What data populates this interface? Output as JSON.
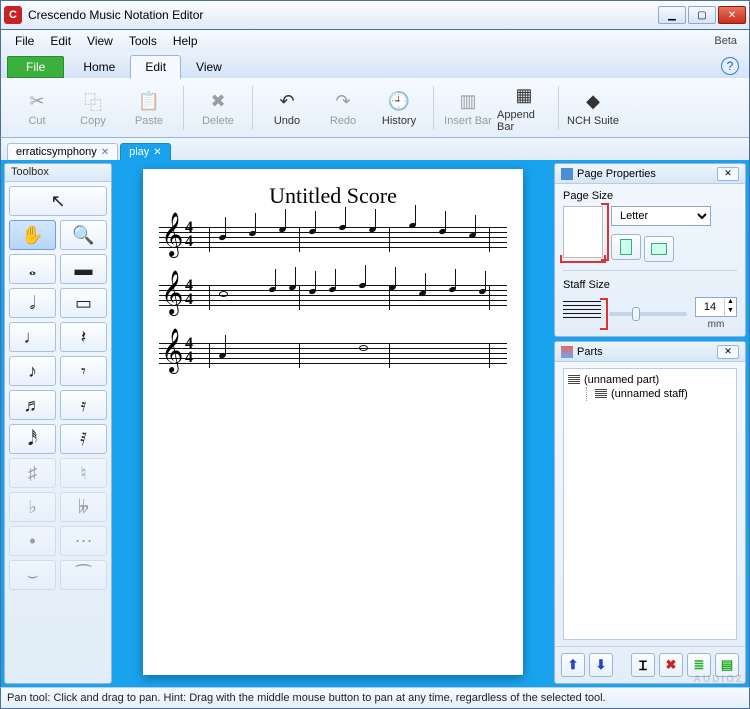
{
  "window": {
    "title": "Crescendo Music Notation Editor",
    "beta": "Beta"
  },
  "menubar": [
    "File",
    "Edit",
    "View",
    "Tools",
    "Help"
  ],
  "ribbon": {
    "file": "File",
    "tabs": [
      "Home",
      "Edit",
      "View"
    ],
    "active": "Edit"
  },
  "toolbar": [
    {
      "id": "cut",
      "label": "Cut",
      "glyph": "✂",
      "disabled": true
    },
    {
      "id": "copy",
      "label": "Copy",
      "glyph": "⿻",
      "disabled": true
    },
    {
      "id": "paste",
      "label": "Paste",
      "glyph": "📋",
      "disabled": true
    },
    {
      "id": "sep"
    },
    {
      "id": "delete",
      "label": "Delete",
      "glyph": "✖",
      "disabled": true
    },
    {
      "id": "sep"
    },
    {
      "id": "undo",
      "label": "Undo",
      "glyph": "↶",
      "disabled": false
    },
    {
      "id": "redo",
      "label": "Redo",
      "glyph": "↷",
      "disabled": true
    },
    {
      "id": "history",
      "label": "History",
      "glyph": "🕘",
      "disabled": false
    },
    {
      "id": "sep"
    },
    {
      "id": "insert-bar",
      "label": "Insert Bar",
      "glyph": "▥",
      "disabled": true
    },
    {
      "id": "append-bar",
      "label": "Append Bar",
      "glyph": "▦",
      "disabled": false
    },
    {
      "id": "sep"
    },
    {
      "id": "nch-suite",
      "label": "NCH Suite",
      "glyph": "◆",
      "disabled": false
    }
  ],
  "docs": [
    {
      "name": "erraticsymphony",
      "active": false
    },
    {
      "name": "play",
      "active": true
    }
  ],
  "toolbox": {
    "title": "Toolbox",
    "tools": [
      {
        "id": "pointer",
        "glyph": "↖",
        "wide": true
      },
      {
        "id": "hand",
        "glyph": "✋",
        "active": true
      },
      {
        "id": "zoom",
        "glyph": "🔍"
      },
      {
        "id": "whole-note",
        "glyph": "𝅝"
      },
      {
        "id": "whole-rest",
        "glyph": "▬"
      },
      {
        "id": "half-note",
        "glyph": "𝅗𝅥"
      },
      {
        "id": "half-rest",
        "glyph": "▭"
      },
      {
        "id": "quarter-note",
        "glyph": "♩"
      },
      {
        "id": "quarter-rest",
        "glyph": "𝄽"
      },
      {
        "id": "eighth-note",
        "glyph": "♪"
      },
      {
        "id": "eighth-rest",
        "glyph": "𝄾"
      },
      {
        "id": "sixteenth-note",
        "glyph": "♬"
      },
      {
        "id": "sixteenth-rest",
        "glyph": "𝄿"
      },
      {
        "id": "thirtysecond-note",
        "glyph": "𝅘𝅥𝅰"
      },
      {
        "id": "thirtysecond-rest",
        "glyph": "𝅀"
      },
      {
        "id": "sharp",
        "glyph": "♯",
        "disabled": true
      },
      {
        "id": "natural",
        "glyph": "♮",
        "disabled": true
      },
      {
        "id": "flat",
        "glyph": "♭",
        "disabled": true
      },
      {
        "id": "double-flat",
        "glyph": "𝄫",
        "disabled": true
      },
      {
        "id": "dot",
        "glyph": "•",
        "disabled": true
      },
      {
        "id": "dots",
        "glyph": "⋯",
        "disabled": true
      },
      {
        "id": "tie",
        "glyph": "⌣",
        "disabled": true
      },
      {
        "id": "slur",
        "glyph": "⁀",
        "disabled": true
      }
    ]
  },
  "score": {
    "title": "Untitled Score",
    "timesig_top": "4",
    "timesig_bot": "4"
  },
  "pageProps": {
    "title": "Page Properties",
    "pageSizeLabel": "Page Size",
    "pageSize": "Letter",
    "staffSizeLabel": "Staff Size",
    "staffSize": "14",
    "unit": "mm"
  },
  "parts": {
    "title": "Parts",
    "items": [
      {
        "label": "(unnamed part)",
        "children": [
          {
            "label": "(unnamed staff)"
          }
        ]
      }
    ]
  },
  "status": "Pan tool: Click and drag to pan. Hint: Drag with the middle mouse button to pan at any time, regardless of the selected tool.",
  "watermark": "AUDIOZ"
}
